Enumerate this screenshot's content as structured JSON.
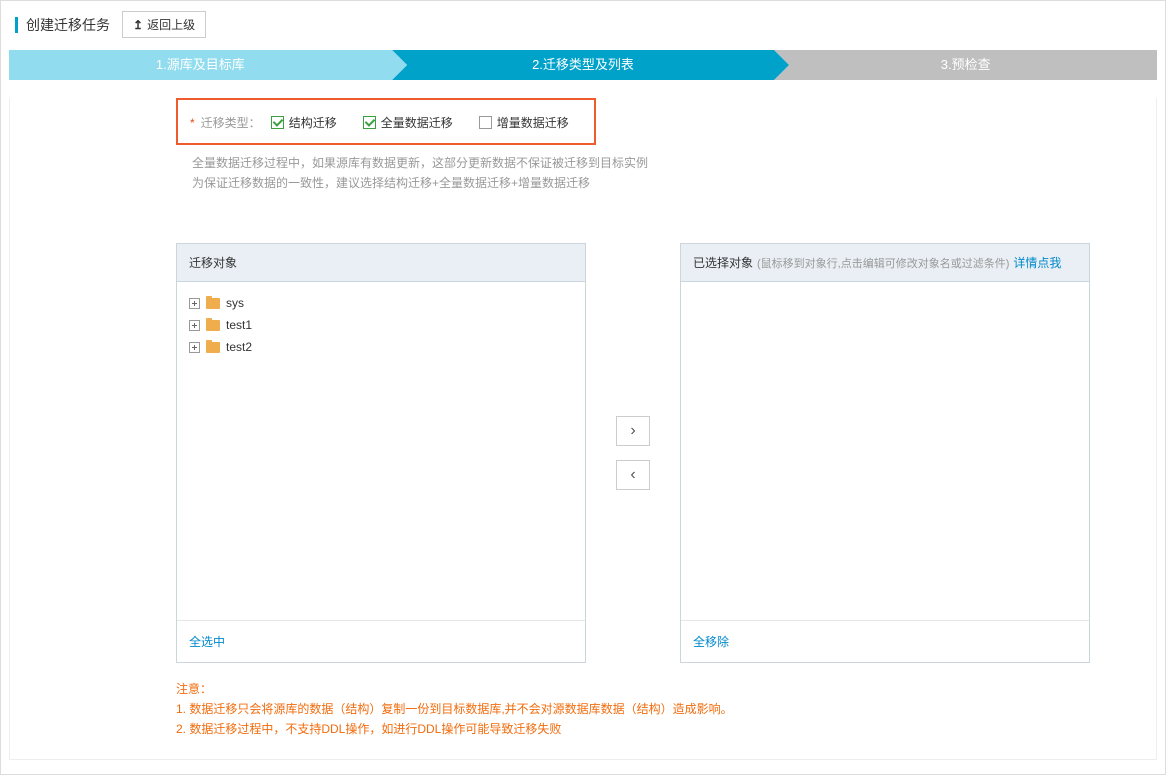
{
  "header": {
    "title": "创建迁移任务",
    "back_label": "返回上级"
  },
  "steps": {
    "s1": "1.源库及目标库",
    "s2": "2.迁移类型及列表",
    "s3": "3.预检查"
  },
  "migration_type": {
    "label": "迁移类型：",
    "opt_structure": "结构迁移",
    "opt_full": "全量数据迁移",
    "opt_incremental": "增量数据迁移"
  },
  "desc": {
    "line1": "全量数据迁移过程中，如果源库有数据更新，这部分更新数据不保证被迁移到目标实例",
    "line2": "为保证迁移数据的一致性，建议选择结构迁移+全量数据迁移+增量数据迁移"
  },
  "source_panel": {
    "title": "迁移对象",
    "items": [
      "sys",
      "test1",
      "test2"
    ],
    "select_all": "全选中"
  },
  "target_panel": {
    "title": "已选择对象",
    "hint": "(鼠标移到对象行,点击编辑可修改对象名或过滤条件)",
    "detail_link": "详情点我",
    "remove_all": "全移除"
  },
  "notice": {
    "title": "注意：",
    "n1": "1. 数据迁移只会将源库的数据（结构）复制一份到目标数据库,并不会对源数据库数据（结构）造成影响。",
    "n2": "2. 数据迁移过程中，不支持DDL操作，如进行DDL操作可能导致迁移失败"
  }
}
